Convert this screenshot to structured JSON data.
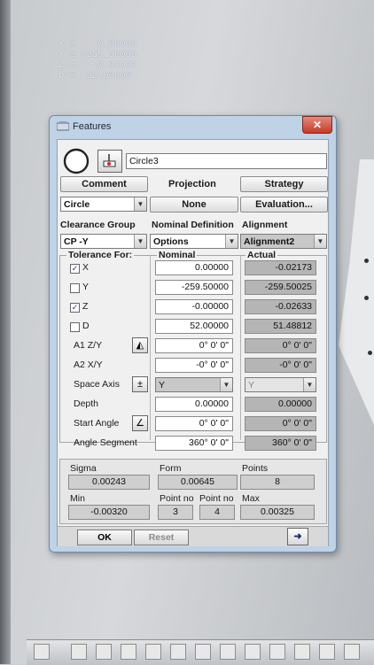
{
  "coords": {
    "x": "X =    0.00000",
    "y": "Y = -259.50000",
    "z": "Z =   -0.00000",
    "d": "D =  52.00000"
  },
  "window": {
    "title": "Features",
    "feature_name": "Circle3"
  },
  "buttons": {
    "comment": "Comment",
    "projection": "Projection",
    "strategy": "Strategy",
    "none": "None",
    "evaluation": "Evaluation...",
    "ok": "OK",
    "reset": "Reset"
  },
  "feature_type": "Circle",
  "labels": {
    "clearance_group": "Clearance Group",
    "nominal_definition": "Nominal Definition",
    "alignment": "Alignment",
    "tolerance_for": "Tolerance For:",
    "nominal": "Nominal",
    "actual": "Actual"
  },
  "dropdowns": {
    "clearance": "CP -Y",
    "options": "Options",
    "alignment": "Alignment2"
  },
  "rows": [
    {
      "label": "X",
      "checked": true,
      "nominal": "0.00000",
      "actual": "-0.02173"
    },
    {
      "label": "Y",
      "checked": false,
      "nominal": "-259.50000",
      "actual": "-259.50025"
    },
    {
      "label": "Z",
      "checked": true,
      "nominal": "-0.00000",
      "actual": "-0.02633"
    },
    {
      "label": "D",
      "checked": false,
      "nominal": "52.00000",
      "actual": "51.48812"
    },
    {
      "label": "A1 Z/Y",
      "nominal": "0° 0' 0\"",
      "actual": "0° 0' 0\""
    },
    {
      "label": "A2 X/Y",
      "nominal": "-0° 0' 0\"",
      "actual": "-0° 0' 0\""
    },
    {
      "label": "Space Axis",
      "nominal": "Y",
      "actual": "Y"
    },
    {
      "label": "Depth",
      "nominal": "0.00000",
      "actual": "0.00000"
    },
    {
      "label": "Start Angle",
      "nominal": "0° 0' 0\"",
      "actual": "0° 0' 0\""
    },
    {
      "label": "Angle Segment",
      "nominal": "360° 0' 0\"",
      "actual": "360° 0' 0\""
    }
  ],
  "stats": {
    "sigma_label": "Sigma",
    "sigma": "0.00243",
    "form_label": "Form",
    "form": "0.00645",
    "points_label": "Points",
    "points": "8",
    "min_label": "Min",
    "min": "-0.00320",
    "pointno1_label": "Point no",
    "pointno1": "3",
    "pointno2_label": "Point no",
    "pointno2": "4",
    "max_label": "Max",
    "max": "0.00325"
  },
  "icons": {
    "close": "close-icon",
    "circle": "circle-feature-icon",
    "probe": "probe-icon",
    "next": "arrow-right-icon"
  }
}
